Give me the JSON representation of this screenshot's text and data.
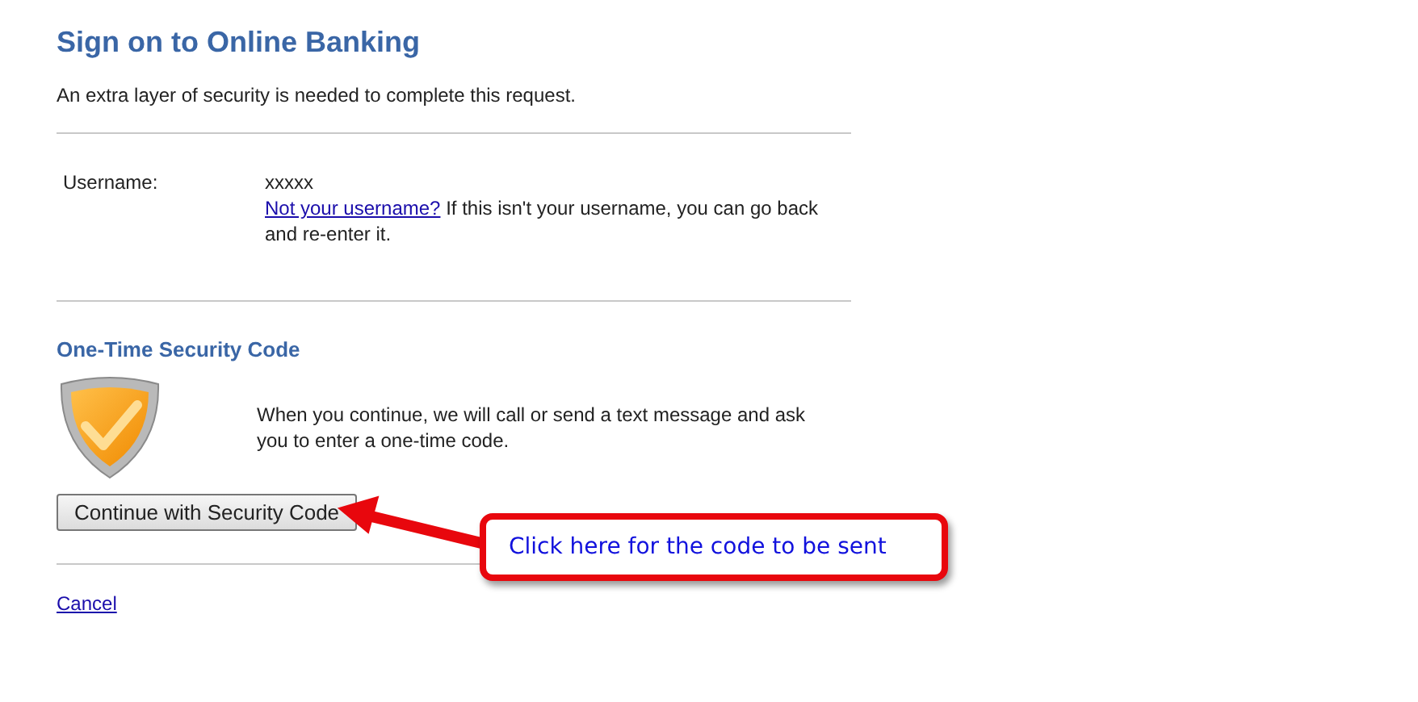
{
  "title": "Sign on to Online Banking",
  "intro": "An extra layer of security is needed to complete this request.",
  "username": {
    "label": "Username:",
    "value": "xxxxx",
    "link": "Not your username?",
    "note": "If this isn't your username, you can go back and re-enter it."
  },
  "security": {
    "heading": "One-Time Security Code",
    "text": "When you continue, we will call or send a text message and ask you to enter a one-time code.",
    "button": "Continue with Security Code"
  },
  "cancel": "Cancel",
  "callout": {
    "text": "Click here for the code to be sent"
  }
}
